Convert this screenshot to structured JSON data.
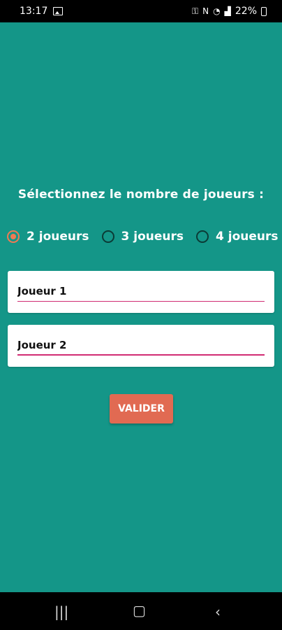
{
  "status_bar": {
    "time": "13:17",
    "battery": "22%",
    "icons": [
      "gallery-icon",
      "key-icon",
      "mute-icon",
      "wifi-icon",
      "signal-icon",
      "battery-icon"
    ]
  },
  "prompt": "Sélectionnez le nombre de joueurs :",
  "radios": [
    {
      "label": "2 joueurs",
      "selected": true
    },
    {
      "label": "3 joueurs",
      "selected": false
    },
    {
      "label": "4 joueurs",
      "selected": false
    }
  ],
  "inputs": [
    {
      "value": "Joueur 1"
    },
    {
      "value": "Joueur 2"
    }
  ],
  "button": {
    "label": "VALIDER"
  },
  "colors": {
    "background": "#149688",
    "accent": "#f07a53",
    "button": "#e16a52",
    "underline": "#d12c73"
  },
  "nav": {
    "icons": [
      "recent-apps-icon",
      "home-icon",
      "back-icon"
    ]
  }
}
